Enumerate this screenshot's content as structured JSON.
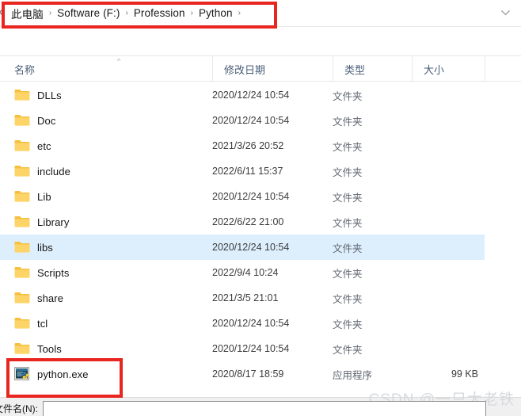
{
  "window": {
    "type": "file-open-dialog",
    "os_style": "Windows 10 File Explorer"
  },
  "addressbar": {
    "back_icon": "chevron-left-icon",
    "dropdown_icon": "chevron-down-icon",
    "separator": "›",
    "crumbs": [
      {
        "label": "此电脑"
      },
      {
        "label": "Software (F:)"
      },
      {
        "label": "Profession"
      },
      {
        "label": "Python"
      }
    ]
  },
  "columns": {
    "name": "名称",
    "date": "修改日期",
    "type": "类型",
    "size": "大小",
    "sort_caret": "^"
  },
  "files": [
    {
      "name": "DLLs",
      "icon": "folder-icon",
      "date": "2020/12/24 10:54",
      "type": "文件夹",
      "size": "",
      "selected": false
    },
    {
      "name": "Doc",
      "icon": "folder-icon",
      "date": "2020/12/24 10:54",
      "type": "文件夹",
      "size": "",
      "selected": false
    },
    {
      "name": "etc",
      "icon": "folder-icon",
      "date": "2021/3/26 20:52",
      "type": "文件夹",
      "size": "",
      "selected": false
    },
    {
      "name": "include",
      "icon": "folder-icon",
      "date": "2022/6/11 15:37",
      "type": "文件夹",
      "size": "",
      "selected": false
    },
    {
      "name": "Lib",
      "icon": "folder-icon",
      "date": "2020/12/24 10:54",
      "type": "文件夹",
      "size": "",
      "selected": false
    },
    {
      "name": "Library",
      "icon": "folder-icon",
      "date": "2022/6/22 21:00",
      "type": "文件夹",
      "size": "",
      "selected": false
    },
    {
      "name": "libs",
      "icon": "folder-icon",
      "date": "2020/12/24 10:54",
      "type": "文件夹",
      "size": "",
      "selected": true
    },
    {
      "name": "Scripts",
      "icon": "folder-icon",
      "date": "2022/9/4 10:24",
      "type": "文件夹",
      "size": "",
      "selected": false
    },
    {
      "name": "share",
      "icon": "folder-icon",
      "date": "2021/3/5 21:01",
      "type": "文件夹",
      "size": "",
      "selected": false
    },
    {
      "name": "tcl",
      "icon": "folder-icon",
      "date": "2020/12/24 10:54",
      "type": "文件夹",
      "size": "",
      "selected": false
    },
    {
      "name": "Tools",
      "icon": "folder-icon",
      "date": "2020/12/24 10:54",
      "type": "文件夹",
      "size": "",
      "selected": false
    },
    {
      "name": "python.exe",
      "icon": "python-exe-icon",
      "date": "2020/8/17 18:59",
      "type": "应用程序",
      "size": "99 KB",
      "selected": false
    }
  ],
  "annotations": {
    "address_highlight_color": "#e8251e",
    "python_highlight_color": "#e8251e"
  },
  "watermark": {
    "text": "CSDN @一只大老铁"
  },
  "bottom": {
    "filename_label": "文件名(N):",
    "filename_value": "",
    "filename_placeholder": ""
  },
  "colors": {
    "selection": "#ddeffc",
    "folder_body": "#fdd36a",
    "folder_tab": "#fbc94a",
    "header_text": "#4a5d78"
  }
}
